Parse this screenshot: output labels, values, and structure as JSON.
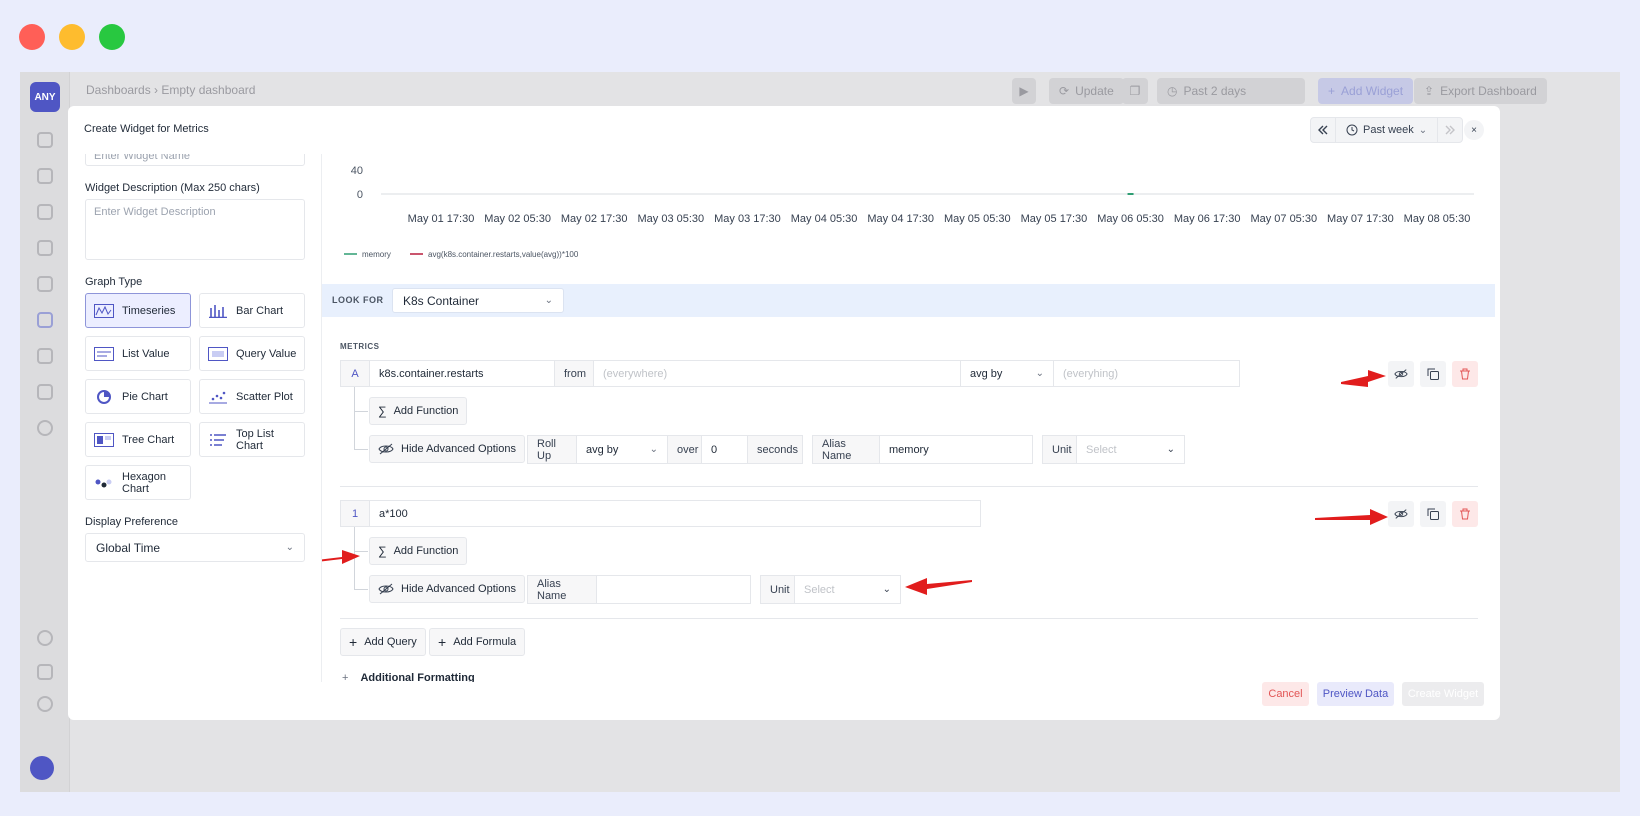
{
  "colors": {
    "window_close": "#ff5f57",
    "window_min": "#febc2e",
    "window_max": "#28c840",
    "accent": "#4f56c4",
    "memory_series": "#2f9e73",
    "formula_series": "#b91c3c",
    "annotation_arrow": "#e11d1d"
  },
  "background_app": {
    "logo": "ANY",
    "breadcrumb": "Dashboards  ›  Empty dashboard",
    "update": "Update",
    "time_range": "Past 2 days",
    "add_widget": "Add Widget",
    "export": "Export Dashboard"
  },
  "modal": {
    "title": "Create Widget for Metrics",
    "time_selector": "Past week",
    "close": "×"
  },
  "left_panel": {
    "widget_name_placeholder": "Enter Widget Name",
    "description_label": "Widget Description (Max 250 chars)",
    "description_placeholder": "Enter Widget Description",
    "graph_type_label": "Graph Type",
    "graph_types": [
      {
        "label": "Timeseries",
        "icon": "timeseries-icon"
      },
      {
        "label": "Bar Chart",
        "icon": "bar-chart-icon"
      },
      {
        "label": "List Value",
        "icon": "list-value-icon"
      },
      {
        "label": "Query Value",
        "icon": "query-value-icon"
      },
      {
        "label": "Pie Chart",
        "icon": "pie-chart-icon"
      },
      {
        "label": "Scatter Plot",
        "icon": "scatter-plot-icon"
      },
      {
        "label": "Tree Chart",
        "icon": "tree-chart-icon"
      },
      {
        "label": "Top List Chart",
        "icon": "top-list-icon"
      },
      {
        "label": "Hexagon Chart",
        "icon": "hexagon-chart-icon"
      }
    ],
    "selected_graph_type": "Timeseries",
    "display_pref_label": "Display Preference",
    "display_pref_value": "Global Time"
  },
  "chart_data": {
    "type": "line",
    "title": "",
    "ylim": [
      0,
      40
    ],
    "y_ticks": [
      "40",
      "0"
    ],
    "x": [
      "May 01 17:30",
      "May 02 05:30",
      "May 02 17:30",
      "May 03 05:30",
      "May 03 17:30",
      "May 04 05:30",
      "May 04 17:30",
      "May 05 05:30",
      "May 05 17:30",
      "May 06 05:30",
      "May 06 17:30",
      "May 07 05:30",
      "May 07 17:30",
      "May 08 05:30"
    ],
    "series": [
      {
        "name": "memory",
        "values": [
          null,
          null,
          null,
          null,
          null,
          null,
          null,
          null,
          null,
          0,
          null,
          null,
          null,
          null
        ]
      },
      {
        "name": "avg(k8s.container.restarts,value(avg))*100",
        "values": []
      }
    ],
    "legend": "bottom-left",
    "grid": false
  },
  "query_builder": {
    "look_for_label": "LOOK FOR",
    "look_for_value": "K8s Container",
    "metrics_label": "METRICS",
    "query_a": {
      "id": "A",
      "metric": "k8s.container.restarts",
      "from_label": "from",
      "from_placeholder": "(everywhere)",
      "agg": "avg by",
      "group_placeholder": "(everyhing)",
      "add_function": "Add Function",
      "hide_advanced": "Hide Advanced Options",
      "rollup_label": "Roll Up",
      "rollup_value": "avg by",
      "over_label": "over",
      "over_value": "0",
      "seconds_label": "seconds",
      "alias_label": "Alias Name",
      "alias_value": "memory",
      "unit_label": "Unit",
      "unit_placeholder": "Select"
    },
    "formula_1": {
      "id": "1",
      "expression": "a*100",
      "add_function": "Add Function",
      "hide_advanced": "Hide Advanced Options",
      "alias_label": "Alias Name",
      "alias_value": "",
      "unit_label": "Unit",
      "unit_placeholder": "Select"
    },
    "add_query": "Add Query",
    "add_formula": "Add Formula",
    "additional_formatting": "Additional Formatting"
  },
  "footer": {
    "cancel": "Cancel",
    "preview": "Preview Data",
    "create": "Create Widget"
  }
}
